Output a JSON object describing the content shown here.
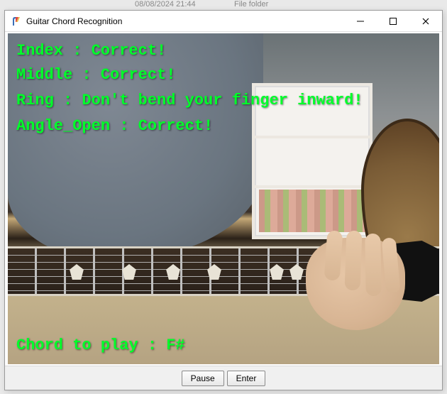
{
  "desktop": {
    "bg_date": "08/08/2024 21:44",
    "bg_label": "File folder"
  },
  "window": {
    "title": "Guitar Chord Recognition"
  },
  "feedback": {
    "lines": [
      {
        "label": "Index",
        "status": "Correct!"
      },
      {
        "label": "Middle",
        "status": "Correct!"
      },
      {
        "label": "Ring",
        "status": "Don't bend your finger inward!"
      },
      {
        "label": "Angle_Open",
        "status": "Correct!"
      }
    ],
    "chord_prefix": "Chord to play : ",
    "chord": "F#"
  },
  "overlay_color": "#00ff2a",
  "buttons": {
    "pause": "Pause",
    "enter": "Enter"
  }
}
